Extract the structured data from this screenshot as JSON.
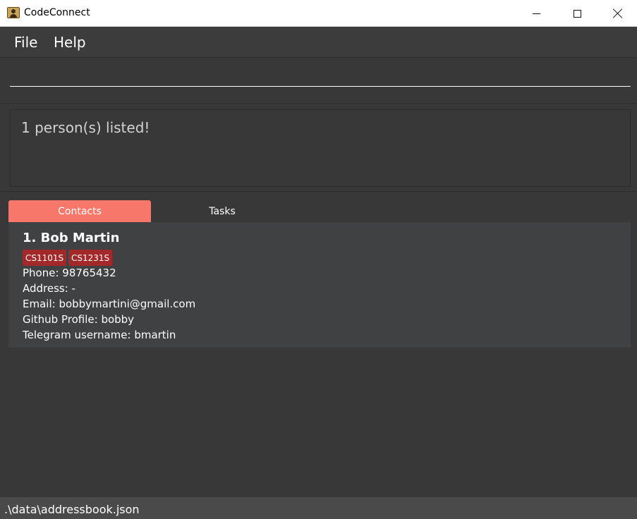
{
  "window": {
    "title": "CodeConnect",
    "icon": "address-book-icon",
    "controls": [
      "minimize-icon",
      "maximize-icon",
      "close-icon"
    ]
  },
  "menu": {
    "file": "File",
    "help": "Help"
  },
  "command": {
    "value": "",
    "placeholder": ""
  },
  "result": {
    "message": "1 person(s) listed!"
  },
  "tabs": {
    "contacts": "Contacts",
    "tasks": "Tasks",
    "selected": "Contacts"
  },
  "contacts": [
    {
      "name": "1.  Bob Martin",
      "tags": [
        "CS1101S",
        "CS1231S"
      ],
      "phone": "Phone: 98765432",
      "address": "Address: -",
      "email": "Email: bobbymartini@gmail.com",
      "github": "Github Profile: bobby",
      "telegram": "Telegram username: bmartin"
    }
  ],
  "status": {
    "path": ".\\data\\addressbook.json"
  },
  "colors": {
    "accent": "#f7786b",
    "tag": "#a3282a",
    "background": "#383838"
  }
}
